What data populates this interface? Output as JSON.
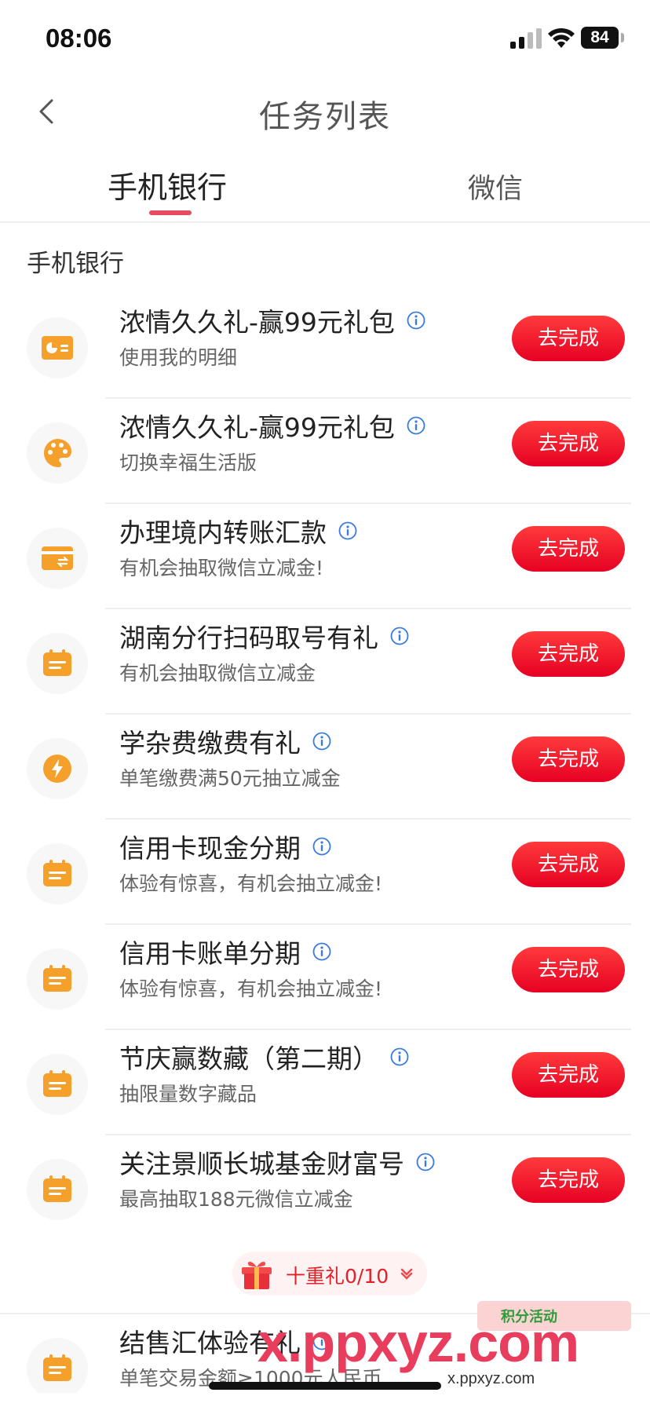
{
  "status_bar": {
    "time": "08:06",
    "battery": "84"
  },
  "nav": {
    "title": "任务列表",
    "back_icon": "chevron-left-icon"
  },
  "tabs": [
    {
      "label": "手机银行",
      "active": true
    },
    {
      "label": "微信",
      "active": false
    }
  ],
  "section": {
    "title": "手机银行"
  },
  "tasks": [
    {
      "title": "浓情久久礼-赢99元礼包",
      "subtitle": "使用我的明细",
      "button": "去完成",
      "icon": "pie-chart-card-icon"
    },
    {
      "title": "浓情久久礼-赢99元礼包",
      "subtitle": "切换幸福生活版",
      "button": "去完成",
      "icon": "palette-icon"
    },
    {
      "title": "办理境内转账汇款",
      "subtitle": "有机会抽取微信立减金!",
      "button": "去完成",
      "icon": "transfer-card-icon"
    },
    {
      "title": "湖南分行扫码取号有礼",
      "subtitle": "有机会抽取微信立减金",
      "button": "去完成",
      "icon": "calendar-icon"
    },
    {
      "title": "学杂费缴费有礼",
      "subtitle": "单笔缴费满50元抽立减金",
      "button": "去完成",
      "icon": "lightning-icon"
    },
    {
      "title": "信用卡现金分期",
      "subtitle": "体验有惊喜，有机会抽立减金!",
      "button": "去完成",
      "icon": "calendar-icon"
    },
    {
      "title": "信用卡账单分期",
      "subtitle": "体验有惊喜，有机会抽立减金!",
      "button": "去完成",
      "icon": "calendar-icon"
    },
    {
      "title": "节庆赢数藏（第二期）",
      "subtitle": "抽限量数字藏品",
      "button": "去完成",
      "icon": "calendar-icon"
    },
    {
      "title": "关注景顺长城基金财富号",
      "subtitle": "最高抽取188元微信立减金",
      "button": "去完成",
      "icon": "calendar-icon"
    }
  ],
  "gift": {
    "label": "十重礼0/10",
    "icon": "gift-icon"
  },
  "partial_task": {
    "title": "结售汇体验有礼",
    "subtitle": "单笔交易金额≥1000元人民币",
    "icon": "calendar-icon"
  },
  "watermark": {
    "big": "x.ppxyz.com",
    "small": "x.ppxyz.com",
    "badge": "积分活动"
  },
  "colors": {
    "accent": "#e60023",
    "icon_orange": "#f5a02a",
    "tab_indicator": "#e84a5f"
  }
}
